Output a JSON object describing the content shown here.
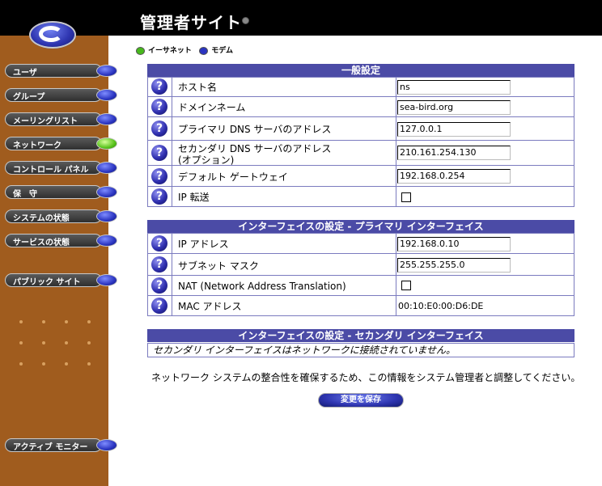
{
  "header": {
    "title": "管理者サイト"
  },
  "tabs": {
    "ethernet": "イーサネット",
    "modem": "モデム"
  },
  "sidebar": {
    "items": [
      {
        "label": "ユーザ",
        "state": "blue"
      },
      {
        "label": "グループ",
        "state": "blue"
      },
      {
        "label": "メーリングリスト",
        "state": "blue"
      },
      {
        "label": "ネットワーク",
        "state": "green"
      },
      {
        "label": "コントロール パネル",
        "state": "blue"
      },
      {
        "label": "保　守",
        "state": "blue"
      },
      {
        "label": "システムの状態",
        "state": "blue"
      },
      {
        "label": "サービスの状態",
        "state": "blue"
      },
      {
        "label": "パブリック サイト",
        "state": "blue"
      },
      {
        "label": "アクティブ モニター",
        "state": "blue"
      }
    ]
  },
  "general": {
    "heading": "一般設定",
    "rows": [
      {
        "label": "ホスト名",
        "value": "ns"
      },
      {
        "label": "ドメインネーム",
        "value": "sea-bird.org"
      },
      {
        "label": "プライマリ DNS サーバのアドレス",
        "value": "127.0.0.1"
      },
      {
        "label": "セカンダリ DNS サーバのアドレス",
        "label2": "(オプション)",
        "value": "210.161.254.130"
      },
      {
        "label": "デフォルト ゲートウェイ",
        "value": "192.168.0.254"
      },
      {
        "label": "IP 転送"
      }
    ]
  },
  "primary": {
    "heading": "インターフェイスの設定 - プライマリ インターフェイス",
    "rows": [
      {
        "label": "IP アドレス",
        "value": "192.168.0.10"
      },
      {
        "label": "サブネット マスク",
        "value": "255.255.255.0"
      },
      {
        "label": "NAT (Network Address Translation)"
      },
      {
        "label": "MAC アドレス",
        "value": "00:10:E0:00:D6:DE"
      }
    ]
  },
  "secondary": {
    "heading": "インターフェイスの設定 - セカンダリ インターフェイス",
    "message": "セカンダリ インターフェイスはネットワークに接続されていません。"
  },
  "note": "ネットワーク システムの整合性を確保するため、この情報をシステム管理者と調整してください。",
  "save_label": "変更を保存",
  "help_glyph": "?",
  "icons": {
    "help": "help-icon",
    "logo": "logo-icon"
  },
  "colors": {
    "header": "#000000",
    "sidebar": "#a05c1e",
    "panel_head": "#4b4ba6",
    "border": "#7b7bbf"
  }
}
